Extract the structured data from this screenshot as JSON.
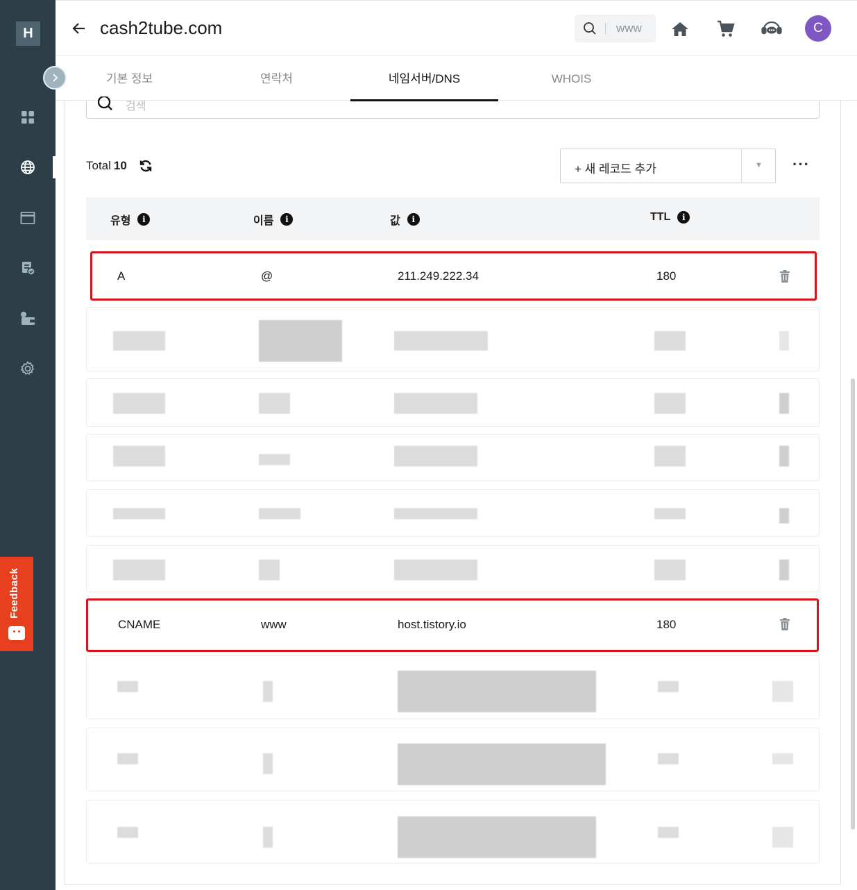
{
  "sidebar": {
    "logo": "H",
    "items": [
      {
        "name": "dashboard-icon"
      },
      {
        "name": "globe-icon",
        "active": true
      },
      {
        "name": "window-icon"
      },
      {
        "name": "invoice-icon"
      },
      {
        "name": "wallet-icon"
      },
      {
        "name": "gear-icon"
      }
    ],
    "feedback_label": "Feedback"
  },
  "header": {
    "domain": "cash2tube.com",
    "search_text": "www",
    "icons": [
      "home-icon",
      "cart-icon",
      "support-chat-icon"
    ],
    "avatar_letter": "C"
  },
  "tabs": [
    {
      "label": "기본 정보",
      "active": false
    },
    {
      "label": "연락처",
      "active": false
    },
    {
      "label": "네임서버/DNS",
      "active": true
    },
    {
      "label": "WHOIS",
      "active": false
    }
  ],
  "filter": {
    "placeholder": "검색"
  },
  "toolbar": {
    "total_label": "Total",
    "total_count": "10",
    "add_record_label": "+ 새 레코드 추가",
    "more_label": "···"
  },
  "table": {
    "headers": [
      "유형",
      "이름",
      "값",
      "TTL"
    ],
    "rows": [
      {
        "type": "A",
        "name": "@",
        "value": "211.249.222.34",
        "ttl": "180",
        "highlighted": true
      },
      {
        "type": "CNAME",
        "name": "www",
        "value": "host.tistory.io",
        "ttl": "180",
        "highlighted": true
      }
    ]
  },
  "colors": {
    "sidebar_bg": "#2c3e47",
    "highlight": "#d3161e",
    "feedback": "#e8401f",
    "avatar": "#7e57c2"
  }
}
